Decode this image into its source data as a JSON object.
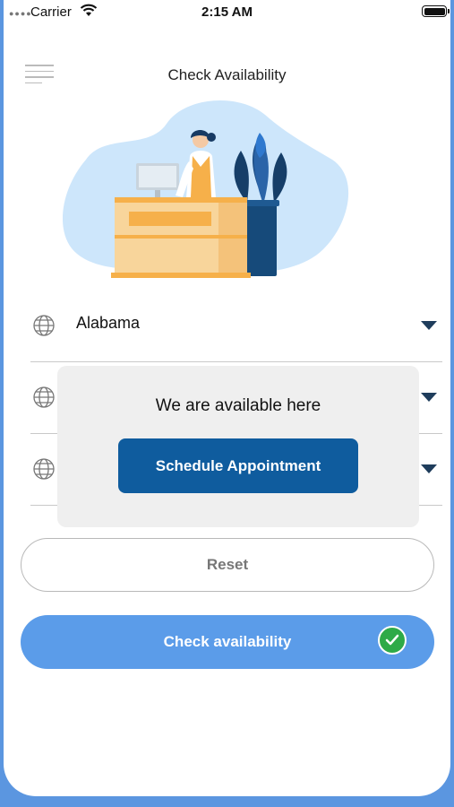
{
  "status_bar": {
    "carrier": "Carrier",
    "time": "2:15 AM",
    "icons": [
      "signal-dots-icon",
      "wifi-icon",
      "battery-icon"
    ]
  },
  "header": {
    "menu_icon": "hamburger-menu-icon",
    "title": "Check Availability"
  },
  "illustration": {
    "name": "reception-desk-illustration",
    "colors": {
      "blob": "#cde6fb",
      "desk": "#f8d59b",
      "desk_accent": "#f6b04a",
      "plant": "#1f4f86",
      "pot": "#164a7a"
    }
  },
  "dropdowns": [
    {
      "icon": "globe-icon",
      "value": "Alabama"
    },
    {
      "icon": "globe-icon",
      "value": ""
    },
    {
      "icon": "globe-icon",
      "value": ""
    }
  ],
  "popup": {
    "message": "We are available here",
    "button_label": "Schedule Appointment"
  },
  "buttons": {
    "reset_label": "Reset",
    "check_label": "Check availability",
    "check_badge_icon": "checkmark-icon"
  },
  "colors": {
    "primary": "#0f5c9e",
    "accent": "#5b9ce9",
    "success": "#2eaa48",
    "frame": "#5b96e0"
  }
}
